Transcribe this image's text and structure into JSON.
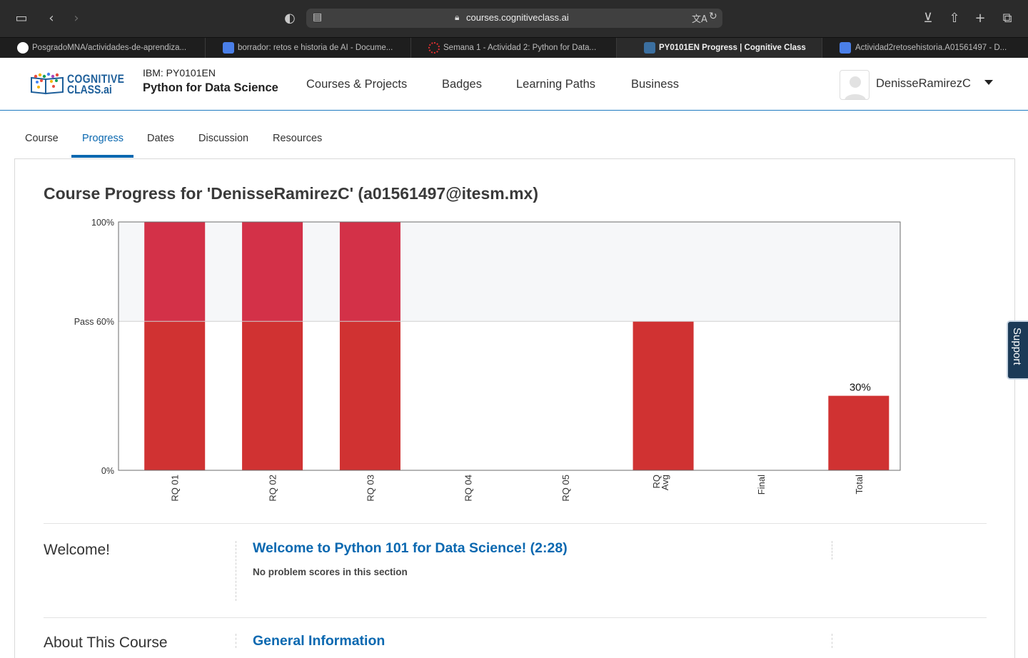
{
  "browser": {
    "url": "courses.cognitiveclass.ai",
    "tabs": [
      {
        "title": "PosgradoMNA/actividades-de-aprendiza...",
        "icon": "github-icon",
        "active": false
      },
      {
        "title": "borrador: retos e historia de AI - Docume...",
        "icon": "google-docs-icon",
        "active": false
      },
      {
        "title": "Semana 1 - Actividad 2: Python for Data...",
        "icon": "canvas-icon",
        "active": false
      },
      {
        "title": "PY0101EN Progress | Cognitive Class",
        "icon": "cognitive-class-icon",
        "active": true
      },
      {
        "title": "Actividad2retosehistoria.A01561497 - D...",
        "icon": "google-docs-icon",
        "active": false
      }
    ]
  },
  "header": {
    "logo_line1": "COGNITIVE",
    "logo_line2": "CLASS.ai",
    "course_code": "IBM: PY0101EN",
    "course_name": "Python for Data Science",
    "nav": [
      "Courses & Projects",
      "Badges",
      "Learning Paths",
      "Business"
    ],
    "username": "DenisseRamirezC"
  },
  "course_tabs": [
    "Course",
    "Progress",
    "Dates",
    "Discussion",
    "Resources"
  ],
  "active_tab": "Progress",
  "page": {
    "title": "Course Progress for 'DenisseRamirezC' (a01561497@itesm.mx)"
  },
  "colors": {
    "bar": "#d03232",
    "bar_above_pass": "#d33148",
    "pass_zone": "#f6f7f9",
    "link": "#0a68b0"
  },
  "chart_data": {
    "type": "bar",
    "categories": [
      "RQ 01",
      "RQ 02",
      "RQ 03",
      "RQ 04",
      "RQ 05",
      "RQ Avg",
      "Final",
      "Total"
    ],
    "values": [
      100,
      100,
      100,
      0,
      0,
      60,
      0,
      30
    ],
    "unit": "%",
    "ylim": [
      0,
      100
    ],
    "y_ticks": [
      {
        "value": 0,
        "label": "0%"
      },
      {
        "value": 60,
        "label": "Pass 60%"
      },
      {
        "value": 100,
        "label": "100%"
      }
    ],
    "pass_threshold": 60,
    "data_labels": [
      {
        "category": "Total",
        "label": "30%"
      }
    ],
    "legend": "none",
    "grid": false
  },
  "sections": [
    {
      "title": "Welcome!",
      "subsection": "Welcome to Python 101 for Data Science! (2:28)",
      "note": "No problem scores in this section"
    },
    {
      "title": "About This Course",
      "subsection": "General Information",
      "note": ""
    }
  ],
  "support_label": "Support"
}
